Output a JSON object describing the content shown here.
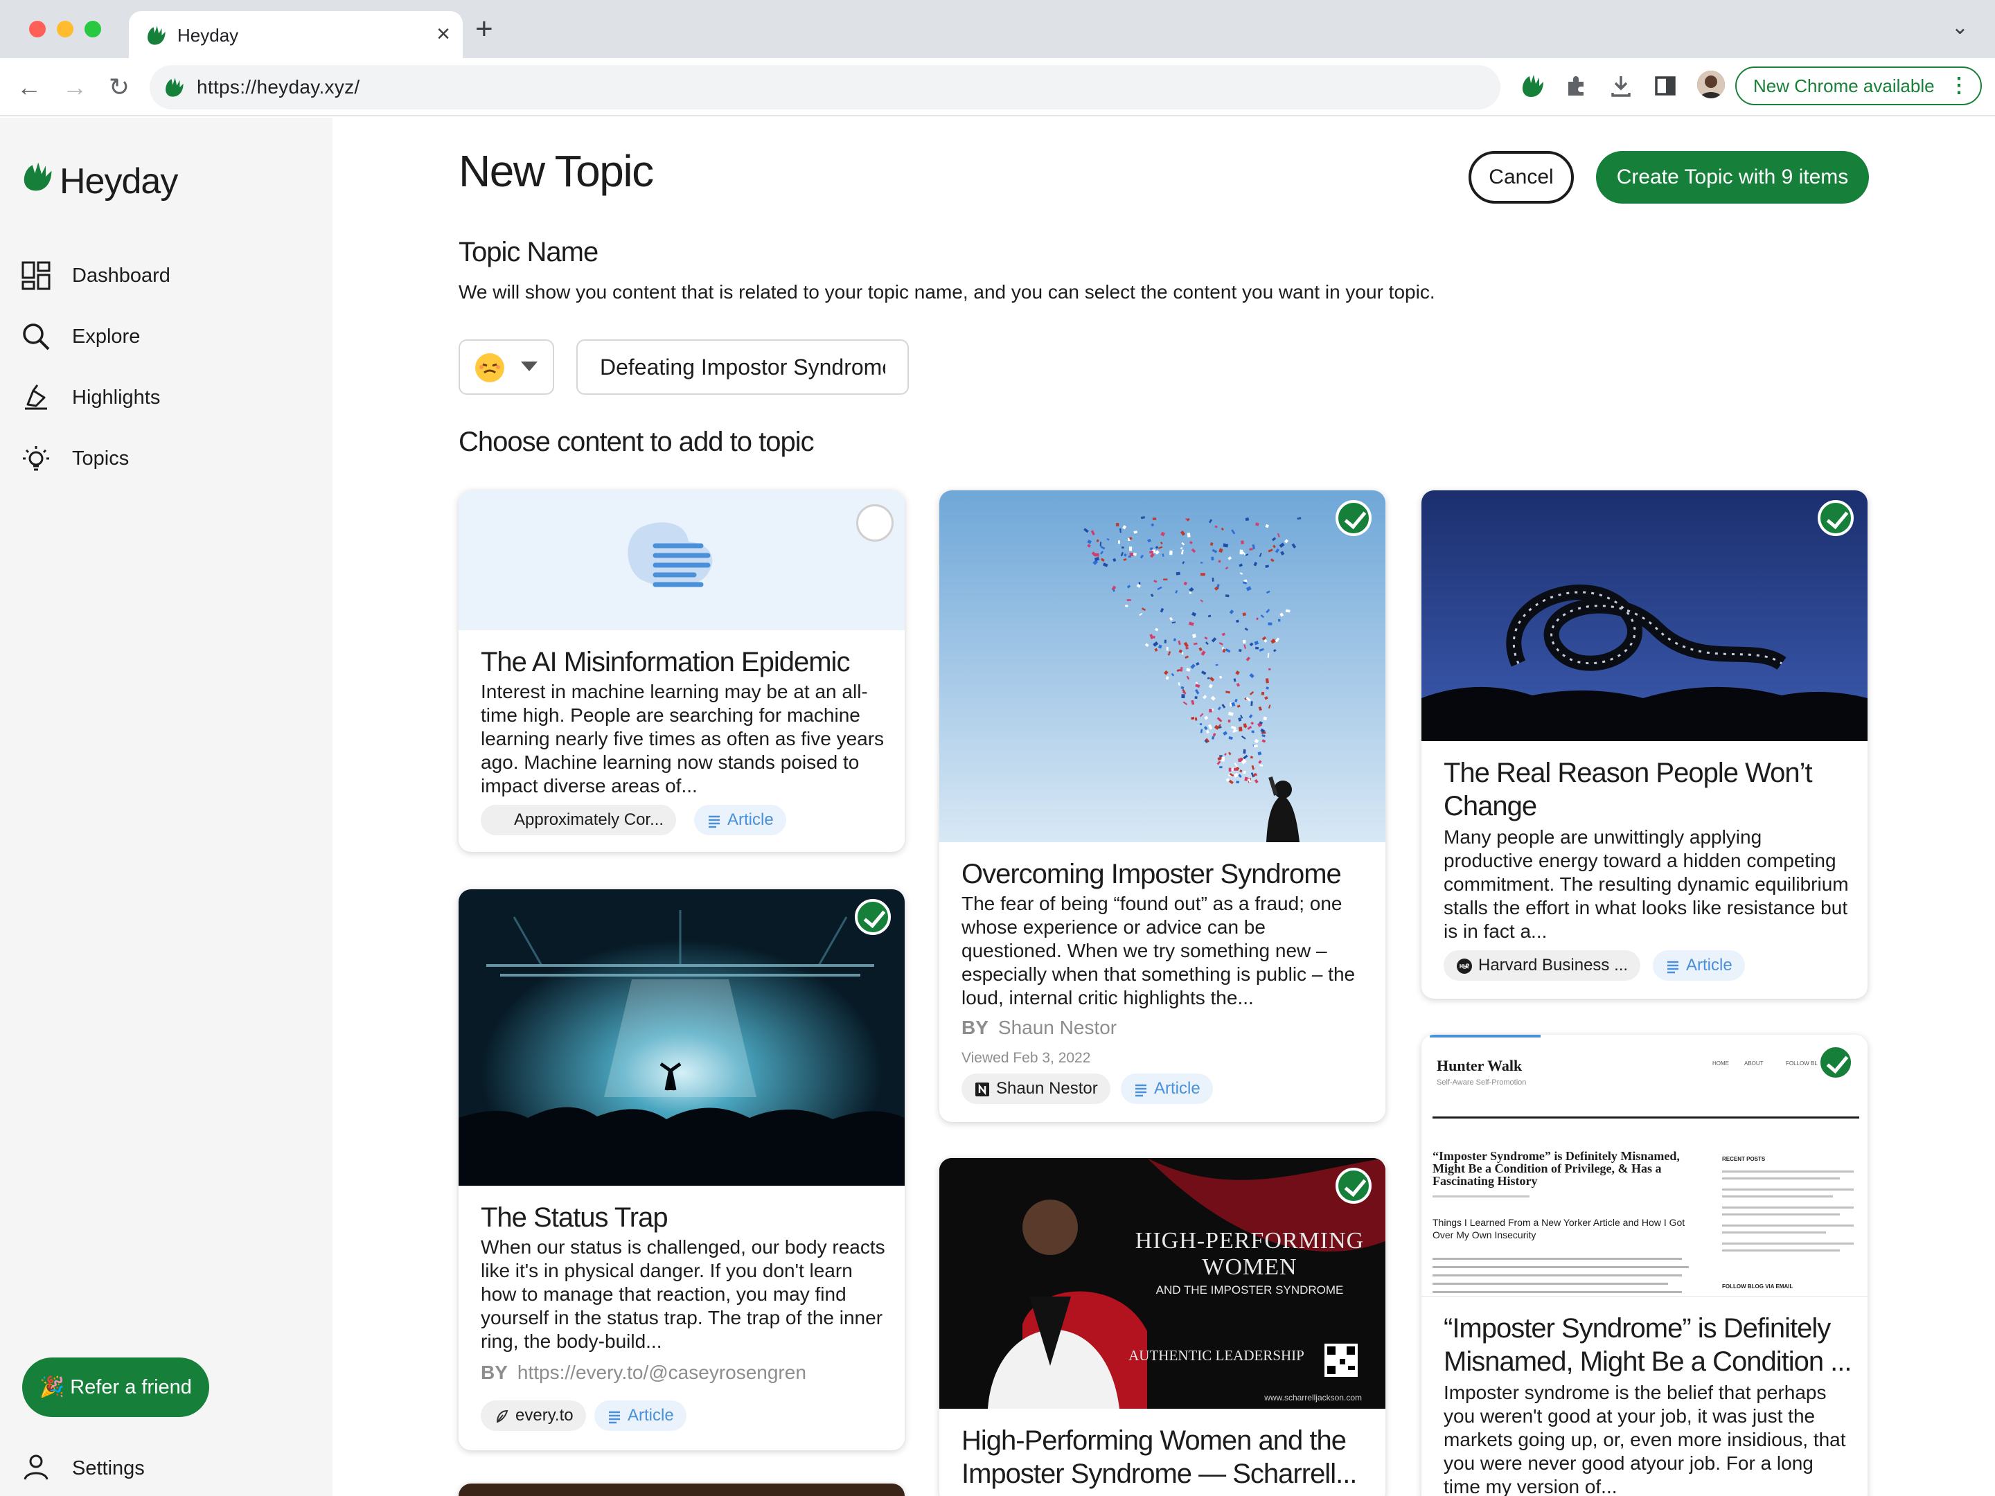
{
  "browser": {
    "tab_title": "Heyday",
    "url": "https://heyday.xyz/",
    "update_label": "New Chrome available"
  },
  "sidebar": {
    "brand": "Heyday",
    "items": [
      {
        "label": "Dashboard",
        "icon": "dashboard-icon"
      },
      {
        "label": "Explore",
        "icon": "search-icon"
      },
      {
        "label": "Highlights",
        "icon": "highlighter-icon"
      },
      {
        "label": "Topics",
        "icon": "lightbulb-icon"
      }
    ],
    "refer_label": "🎉 Refer a friend",
    "settings_label": "Settings"
  },
  "header": {
    "title": "New Topic",
    "cancel_label": "Cancel",
    "create_label": "Create Topic with 9 items"
  },
  "form": {
    "topic_name_label": "Topic Name",
    "help_text": "We will show you content that is related to your topic name, and you can select the content you want in your topic.",
    "topic_value": "Defeating Impostor Syndrome",
    "choose_label": "Choose content to add to topic"
  },
  "colors": {
    "brand_green": "#16803a",
    "article_blue": "#4a90d9"
  },
  "cards": [
    {
      "title": "The AI Misinformation Epidemic",
      "desc": "Interest in machine learning may be at an all-time high. People are searching for machine learning nearly five times as often as five years ago. Machine learning now stands poised to impact diverse areas of...",
      "source": "Approximately Cor...",
      "type": "Article",
      "selected": false
    },
    {
      "title": "The Status Trap",
      "desc": "When our status is challenged, our body reacts like it's in physical danger. If you don't learn how to manage that reaction, you may find yourself in the status trap. The trap of the inner ring, the body-build...",
      "by_prefix": "BY",
      "by": "https://every.to/@caseyrosengren",
      "source": "every.to",
      "type": "Article",
      "selected": true
    },
    {
      "title": "Overcoming Imposter Syndrome",
      "desc": "The fear of being “found out” as a fraud; one whose experience or advice can be questioned. When we try something new – especially when that something is public – the loud, internal critic highlights the...",
      "by_prefix": "BY",
      "by": "Shaun Nestor",
      "viewed": "Viewed Feb 3, 2022",
      "source": "Shaun Nestor",
      "type": "Article",
      "selected": true
    },
    {
      "title": "High-Performing Women and the Imposter Syndrome — Scharrell...",
      "selected": true,
      "thumb_text": {
        "line1": "HIGH-PERFORMING",
        "line2": "WOMEN",
        "line3": "AND THE IMPOSTER SYNDROME",
        "line4": "AUTHENTIC LEADERSHIP",
        "footer": "www.scharrelljackson.com"
      }
    },
    {
      "title": "The Real Reason People Won’t Change",
      "desc": "Many people are unwittingly applying productive energy toward a hidden competing commitment. The resulting dynamic equilibrium stalls the effort in what looks like resistance but is in fact a...",
      "source": "Harvard Business ...",
      "type": "Article",
      "selected": true
    },
    {
      "title": "“Imposter Syndrome” is Definitely Misnamed, Might Be a Condition ...",
      "desc": "Imposter syndrome is the belief that perhaps you weren't good at your job, it was just the markets going up, or, even more insidious, that you were never good atyour job. For a long time my version of...",
      "selected": true,
      "thumb_text": {
        "site": "Hunter Walk",
        "tagline": "Self-Aware Self-Promotion",
        "nav1": "HOME",
        "nav2": "ABOUT",
        "nav3": "FOLLOW BLO",
        "headline": "“Imposter Syndrome” is Definitely Misnamed, Might Be a Condition of Privilege, & Has a Fascinating History",
        "sub": "Things I Learned From a New Yorker Article and How I Got Over My Own Insecurity",
        "recent": "RECENT POSTS",
        "follow": "FOLLOW BLOG VIA EMAIL"
      }
    }
  ]
}
